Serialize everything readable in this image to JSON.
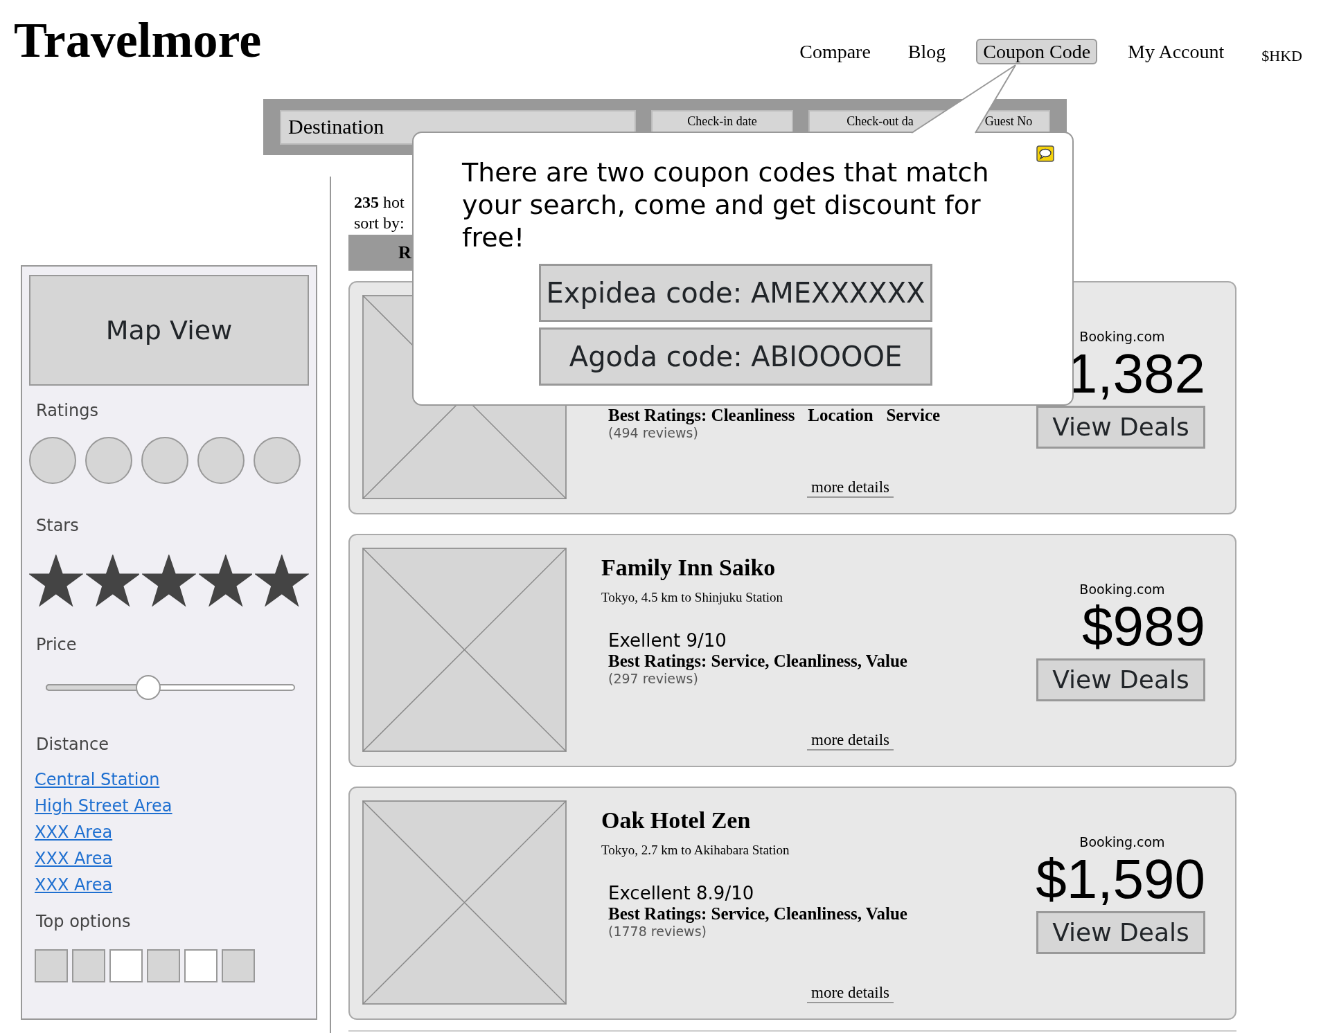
{
  "logo": "Travelmore",
  "nav": [
    {
      "label": "Compare",
      "kind": "link",
      "selected": false
    },
    {
      "label": "Blog",
      "kind": "link",
      "selected": false
    },
    {
      "label": "Coupon Code",
      "kind": "link",
      "selected": true
    },
    {
      "label": "My Account",
      "kind": "link",
      "selected": false
    },
    {
      "label": "$HKD",
      "kind": "currency",
      "selected": false
    }
  ],
  "search": {
    "fields": [
      {
        "label": "Destination",
        "kind": "main"
      },
      {
        "label": "Check-in date",
        "kind": "small"
      },
      {
        "label": "Check-out da",
        "kind": "small"
      },
      {
        "label": "Guest No",
        "kind": "small"
      }
    ]
  },
  "coupon_popup": {
    "message": "There are two coupon codes that match your search, come and get discount for free!",
    "codes": [
      "Expidea code: AMEXXXXXX",
      "Agoda code: ABIOOOOE"
    ]
  },
  "filters": {
    "map_button": "Map View",
    "ratings": {
      "label": "Ratings",
      "options": [
        {
          "selected": false
        },
        {
          "selected": false
        },
        {
          "selected": false
        },
        {
          "selected": false
        },
        {
          "selected": false
        }
      ]
    },
    "stars": {
      "label": "Stars",
      "stars": 5
    },
    "price": {
      "label": "Price",
      "level": 0.41
    },
    "distance": {
      "label": "Distance",
      "links": [
        "Central Station",
        "High Street Area",
        "XXX Area",
        "XXX Area",
        "XXX Area"
      ]
    },
    "top_options": {
      "label": "Top options",
      "options": [
        {
          "checked": false
        },
        {
          "checked": false
        },
        {
          "checked": true
        },
        {
          "checked": false
        },
        {
          "checked": true
        },
        {
          "checked": false
        }
      ]
    }
  },
  "results": {
    "count": "**235** hot",
    "sort_label": "sort by:",
    "sort_tab": "R"
  },
  "hotels": [
    {
      "best_ratings": "Best Ratings: Cleanliness   Location   Service",
      "reviews": "(494 reviews)",
      "more": "more details",
      "source": "Booking.com",
      "price": "1,382",
      "button": "View Deals"
    },
    {
      "name": "Family Inn Saiko",
      "location": "Tokyo, 4.5 km to Shinjuku Station",
      "rating": "Exellent 9/10",
      "best_ratings": "Best Ratings: Service, Cleanliness, Value",
      "reviews": "(297 reviews)",
      "more": "more details",
      "source": "Booking.com",
      "price": "$989",
      "button": "View Deals"
    },
    {
      "name": "Oak Hotel Zen",
      "location": "Tokyo, 2.7 km to Akihabara Station",
      "rating": "Excellent 8.9/10",
      "best_ratings": "Best Ratings: Service, Cleanliness, Value",
      "reviews": "(1778 reviews)",
      "more": "more details",
      "source": "Booking.com",
      "price": "$1,590",
      "button": "View Deals"
    }
  ]
}
